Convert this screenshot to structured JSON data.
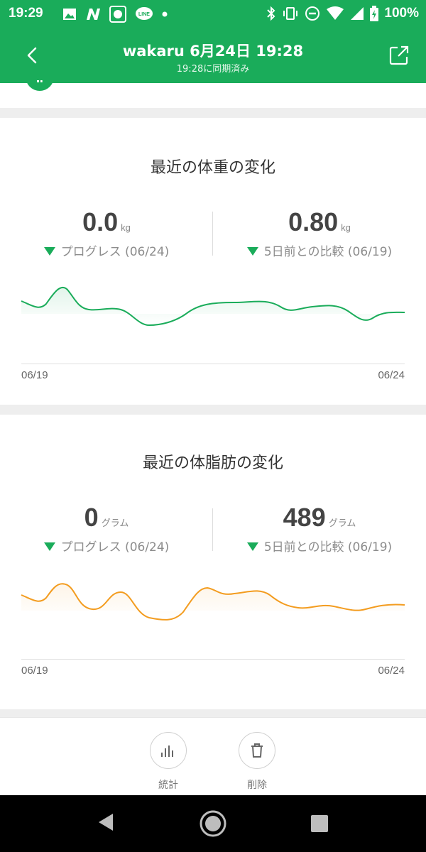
{
  "status_bar": {
    "time": "19:29",
    "battery_percent": "100%",
    "icons": [
      "image-icon",
      "n-app-icon",
      "character-app-icon",
      "line-app-icon",
      "dot-icon",
      "bluetooth-icon",
      "vibrate-icon",
      "dnd-icon",
      "wifi-icon",
      "signal-icon",
      "battery-icon"
    ]
  },
  "app_bar": {
    "title": "wakaru 6月24日 19:28",
    "subtitle": "19:28に同期済み",
    "back_icon": "chevron-left-icon",
    "share_icon": "share-icon"
  },
  "weight_card": {
    "title": "最近の体重の変化",
    "left": {
      "value": "0.0",
      "unit": "kg",
      "label": "プログレス (06/24)"
    },
    "right": {
      "value": "0.80",
      "unit": "kg",
      "label": "5日前との比較 (06/19)"
    },
    "x_start": "06/19",
    "x_end": "06/24",
    "line_color": "#1aac5a"
  },
  "fat_card": {
    "title": "最近の体脂肪の変化",
    "left": {
      "value": "0",
      "unit": "グラム",
      "label": "プログレス (06/24)"
    },
    "right": {
      "value": "489",
      "unit": "グラム",
      "label": "5日前との比較 (06/19)"
    },
    "x_start": "06/19",
    "x_end": "06/24",
    "line_color": "#f39c1f"
  },
  "toolbar": {
    "stats_label": "統計",
    "delete_label": "削除"
  },
  "colors": {
    "brand": "#1aac5a",
    "down_arrow": "#1aac5a",
    "fat_line": "#f39c1f"
  }
}
